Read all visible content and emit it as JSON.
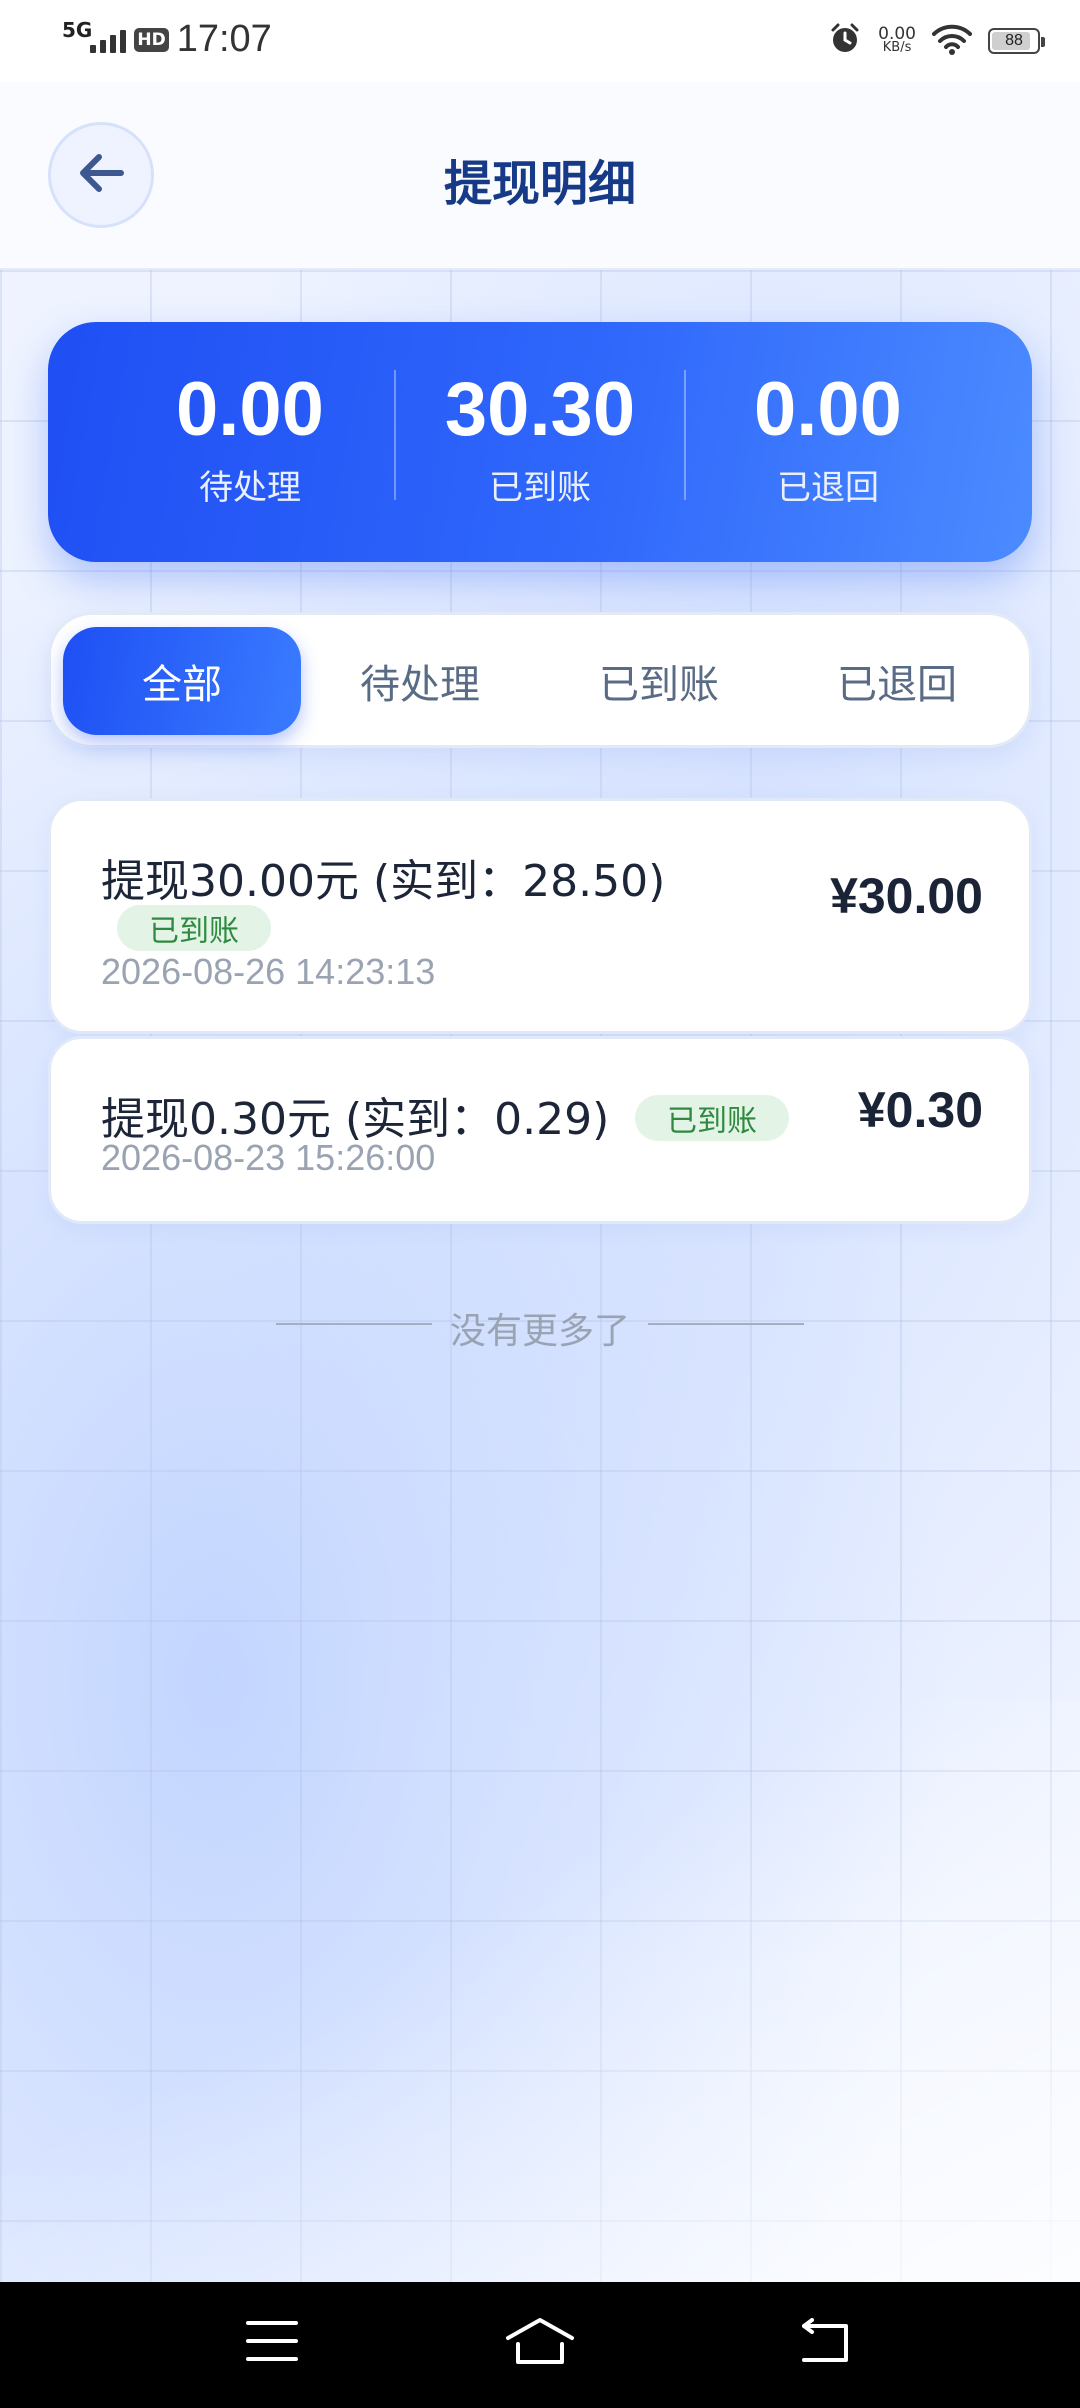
{
  "status_bar": {
    "network": "5G",
    "hd": "HD",
    "time": "17:07",
    "speed_value": "0.00",
    "speed_unit": "KB/s",
    "battery": "88"
  },
  "header": {
    "title": "提现明细",
    "back_icon": "arrow-left-icon"
  },
  "summary": {
    "items": [
      {
        "value": "0.00",
        "label": "待处理"
      },
      {
        "value": "30.30",
        "label": "已到账"
      },
      {
        "value": "0.00",
        "label": "已退回"
      }
    ]
  },
  "tabs": [
    {
      "label": "全部",
      "active": true
    },
    {
      "label": "待处理",
      "active": false
    },
    {
      "label": "已到账",
      "active": false
    },
    {
      "label": "已退回",
      "active": false
    }
  ],
  "records": [
    {
      "title": "提现30.00元 (实到：28.50)",
      "status": "已到账",
      "time": "2026-08-26 14:23:13",
      "amount": "¥30.00"
    },
    {
      "title": "提现0.30元 (实到：0.29)",
      "status": "已到账",
      "time": "2026-08-23 15:26:00",
      "amount": "¥0.30"
    }
  ],
  "list_end": "没有更多了",
  "colors": {
    "accent": "#2f67fb",
    "title": "#173a86",
    "success_bg": "#e3f4e6",
    "success_text": "#2f8a3f"
  },
  "nav": [
    "menu-icon",
    "home-icon",
    "back-icon"
  ]
}
